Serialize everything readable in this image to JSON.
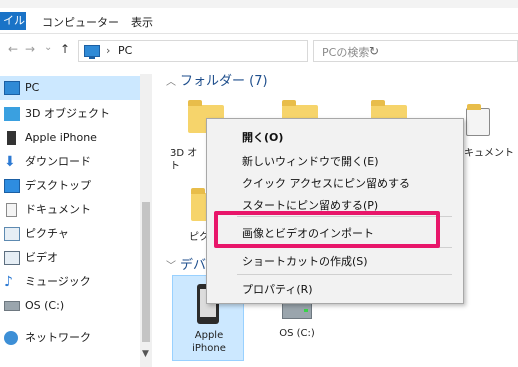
{
  "ribbon": {
    "file_tab": "イル",
    "tabs": [
      "コンピューター",
      "表示"
    ]
  },
  "address": {
    "back": "←",
    "forward": "→",
    "dropdown": "⌄",
    "up": "↑",
    "separator": "›",
    "breadcrumb": "PC",
    "refresh": "↻",
    "search_placeholder": "PCの検索"
  },
  "navpane": {
    "items": [
      {
        "label": "PC",
        "icon": "pc-icon",
        "selected": true
      },
      {
        "label": "3D オブジェクト",
        "icon": "3d-objects-icon"
      },
      {
        "label": "Apple iPhone",
        "icon": "phone-icon"
      },
      {
        "label": "ダウンロード",
        "icon": "download-icon"
      },
      {
        "label": "デスクトップ",
        "icon": "desktop-icon"
      },
      {
        "label": "ドキュメント",
        "icon": "document-icon"
      },
      {
        "label": "ピクチャ",
        "icon": "picture-icon"
      },
      {
        "label": "ビデオ",
        "icon": "video-icon"
      },
      {
        "label": "ミュージック",
        "icon": "music-icon"
      },
      {
        "label": "OS (C:)",
        "icon": "drive-icon"
      },
      {
        "label": "ネットワーク",
        "icon": "network-icon"
      }
    ]
  },
  "content": {
    "folders_header": "フォルダー (7)",
    "devices_header": "デバ",
    "folder_labels": {
      "objects_partial_1": "3D オ",
      "objects_partial_2": "ト",
      "documents_partial": "キュメント",
      "pictures_partial": "ピク"
    },
    "devices": [
      {
        "label_line1": "Apple",
        "label_line2": "iPhone"
      },
      {
        "label_line1": "OS (C:)"
      }
    ]
  },
  "context_menu": {
    "items": [
      {
        "label": "開く(O)",
        "bold": true
      },
      {
        "label": "新しいウィンドウで開く(E)"
      },
      {
        "label": "クイック アクセスにピン留めする"
      },
      {
        "label": "スタートにピン留めする(P)"
      },
      {
        "label": "画像とビデオのインポート",
        "highlighted": true
      },
      {
        "label": "ショートカットの作成(S)"
      },
      {
        "label": "プロパティ(R)"
      }
    ]
  },
  "colors": {
    "selection": "#cce8ff",
    "highlight_box": "#e8166a",
    "group_header": "#1e4e8c"
  }
}
